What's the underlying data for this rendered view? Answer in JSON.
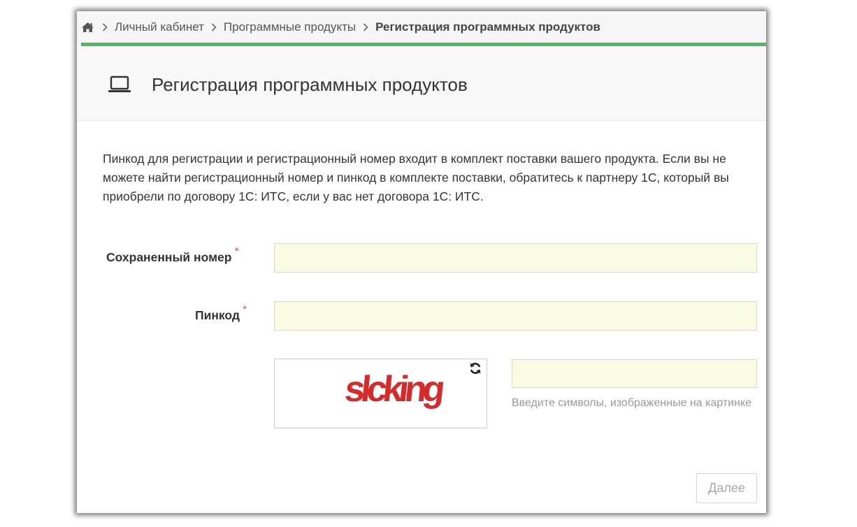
{
  "breadcrumb": {
    "home_icon": "home-icon",
    "items": [
      "Личный кабинет",
      "Программные продукты"
    ],
    "current": "Регистрация программных продуктов"
  },
  "accent_color": "#4cb861",
  "panel": {
    "icon": "laptop-icon",
    "title": "Регистрация программных продуктов"
  },
  "intro": "Пинкод для регистрации и регистрационный номер входит в комплект поставки вашего продукта. Если вы не можете найти регистрационный номер и пинкод в комплекте поставки, обратитесь к партнеру 1С, который вы приобрели по договору 1С: ИТС, если у вас нет договора 1С: ИТС.",
  "form": {
    "saved_number": {
      "label": "Сохраненный номер",
      "required_mark": "*",
      "value": ""
    },
    "pincode": {
      "label": "Пинкод",
      "required_mark": "*",
      "value": ""
    },
    "captcha": {
      "image_text": "slcking",
      "refresh_icon": "refresh-icon",
      "input_value": "",
      "hint": "Введите символы, изображенные на картинке"
    }
  },
  "buttons": {
    "next": "Далее"
  }
}
